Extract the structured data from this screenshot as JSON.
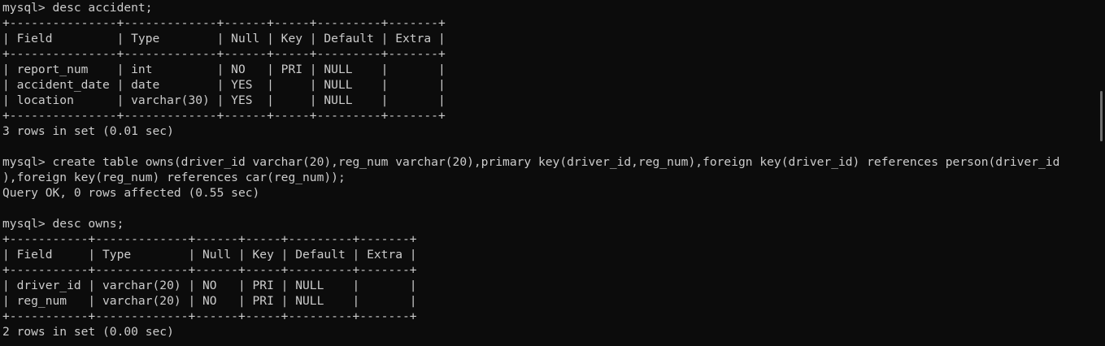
{
  "terminal": {
    "lines": [
      "mysql> desc accident;",
      "+---------------+-------------+------+-----+---------+-------+",
      "| Field         | Type        | Null | Key | Default | Extra |",
      "+---------------+-------------+------+-----+---------+-------+",
      "| report_num    | int         | NO   | PRI | NULL    |       |",
      "| accident_date | date        | YES  |     | NULL    |       |",
      "| location      | varchar(30) | YES  |     | NULL    |       |",
      "+---------------+-------------+------+-----+---------+-------+",
      "3 rows in set (0.01 sec)",
      "",
      "mysql> create table owns(driver_id varchar(20),reg_num varchar(20),primary key(driver_id,reg_num),foreign key(driver_id) references person(driver_id",
      "),foreign key(reg_num) references car(reg_num));",
      "Query OK, 0 rows affected (0.55 sec)",
      "",
      "mysql> desc owns;",
      "+-----------+-------------+------+-----+---------+-------+",
      "| Field     | Type        | Null | Key | Default | Extra |",
      "+-----------+-------------+------+-----+---------+-------+",
      "| driver_id | varchar(20) | NO   | PRI | NULL    |       |",
      "| reg_num   | varchar(20) | NO   | PRI | NULL    |       |",
      "+-----------+-------------+------+-----+---------+-------+",
      "2 rows in set (0.00 sec)"
    ]
  },
  "colors": {
    "background": "#0c0c0c",
    "text": "#cccccc",
    "scrollbar": "#6e6e6e"
  }
}
